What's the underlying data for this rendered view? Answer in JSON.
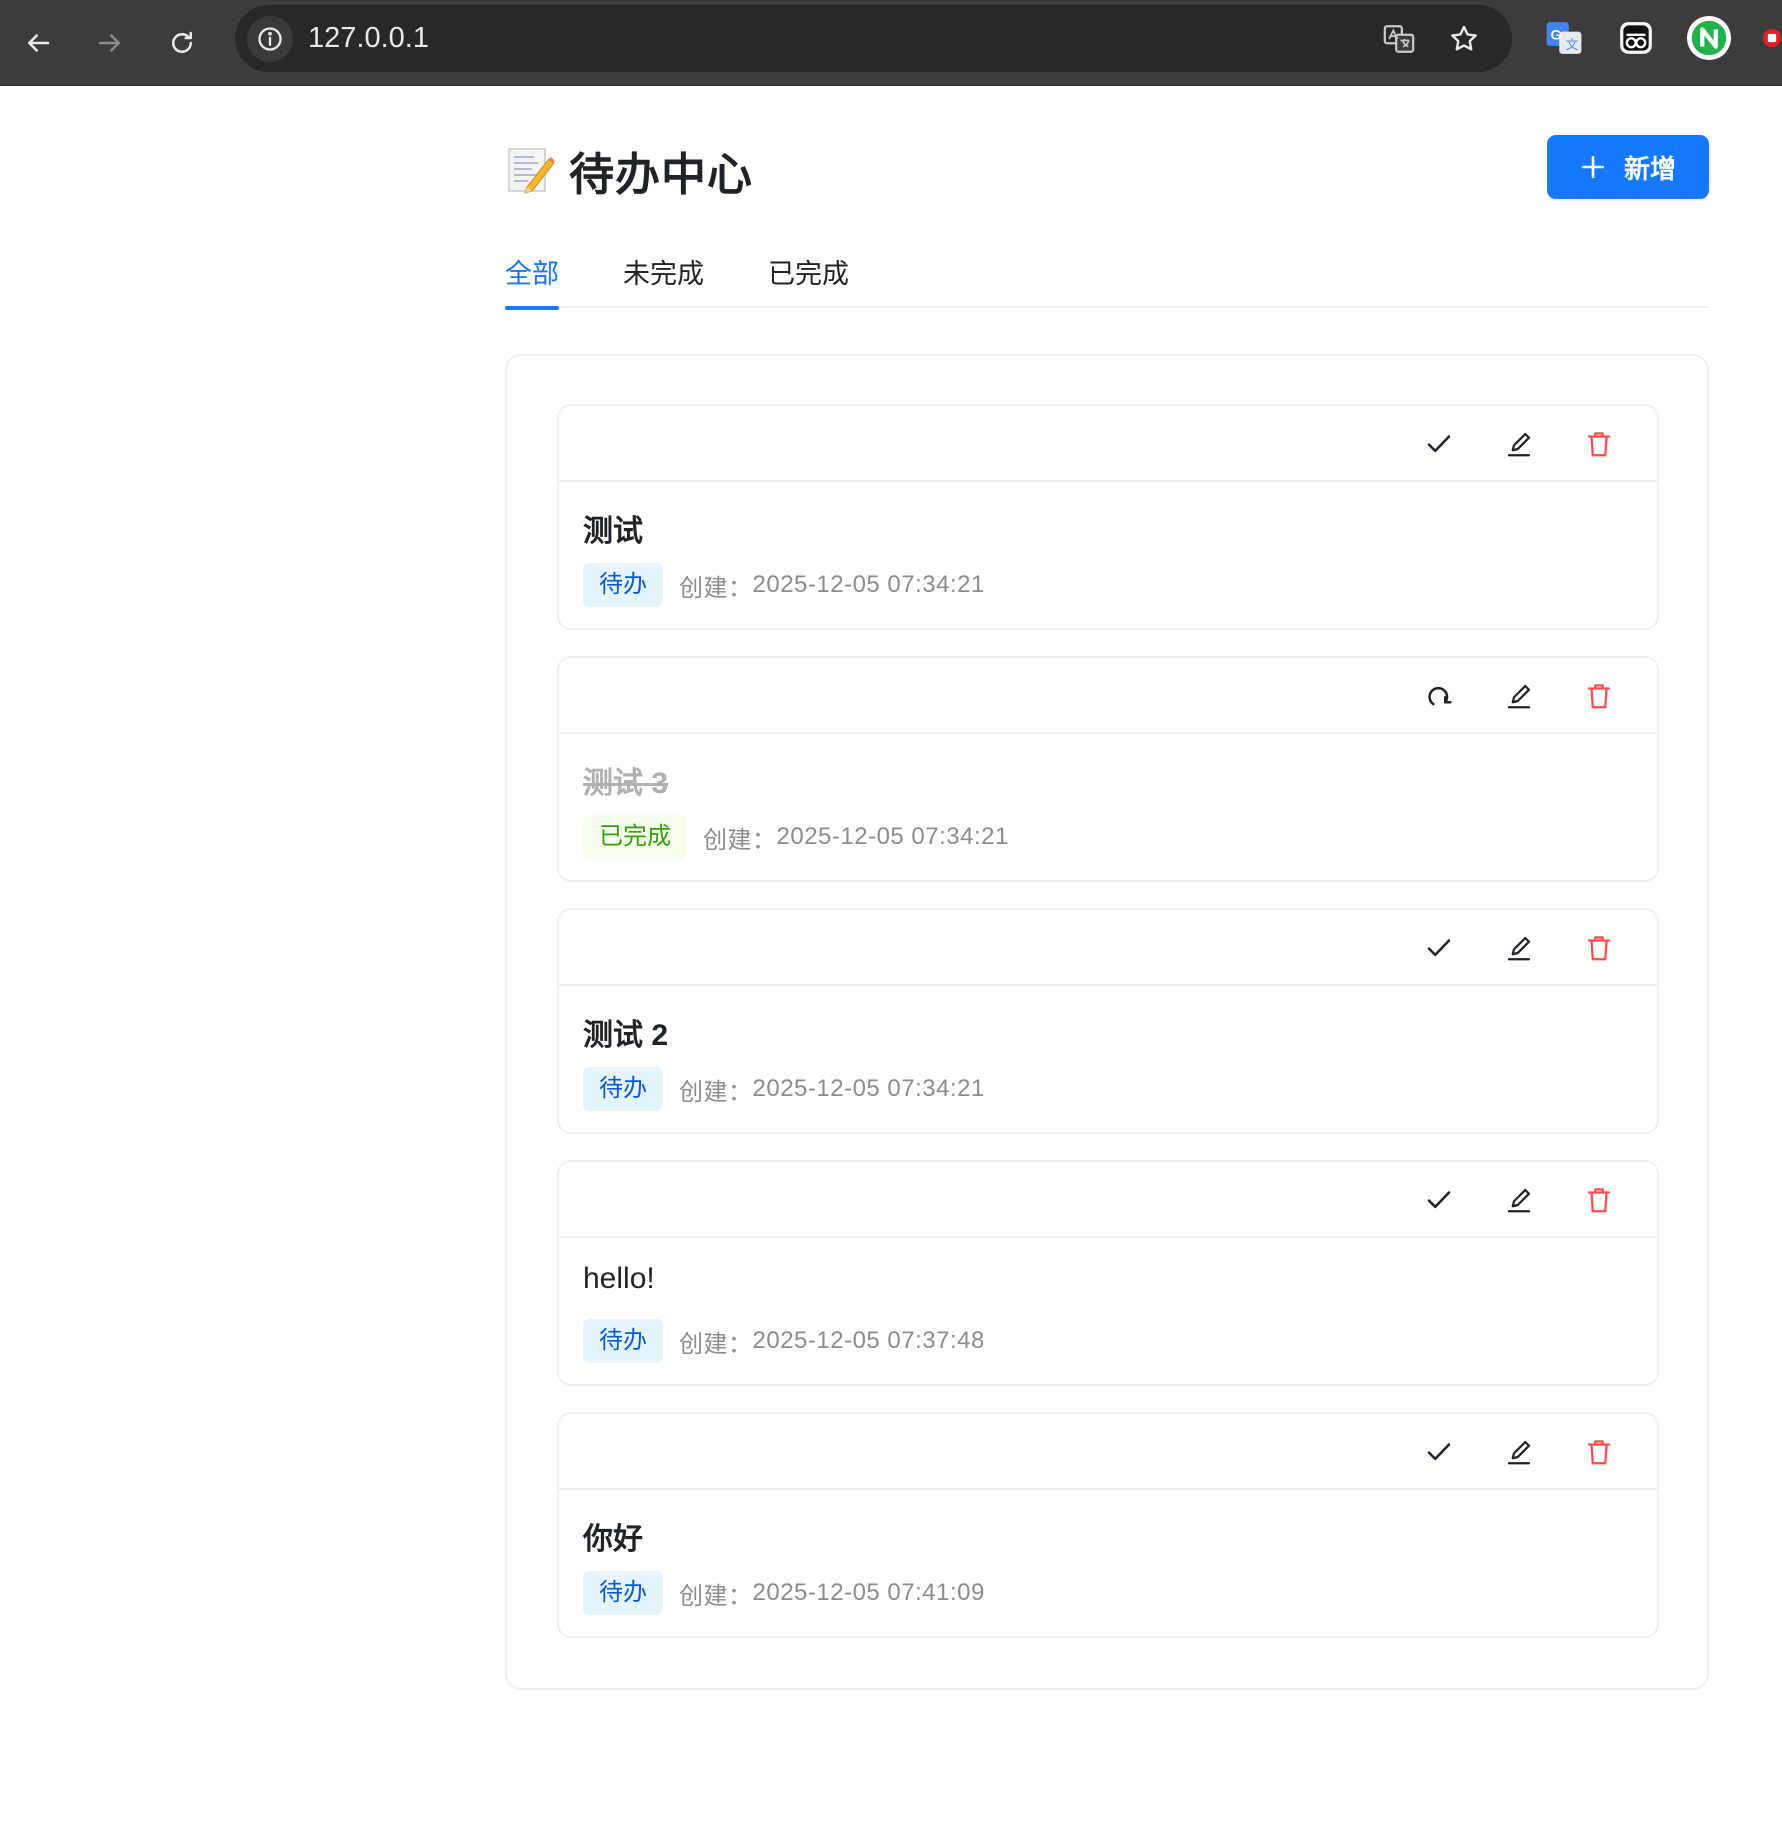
{
  "browser": {
    "url": "127.0.0.1"
  },
  "header": {
    "title": "待办中心",
    "add_label": "新增"
  },
  "tabs": [
    {
      "label": "全部"
    },
    {
      "label": "未完成"
    },
    {
      "label": "已完成"
    }
  ],
  "todos": [
    {
      "title": "测试",
      "status_label": "待办",
      "created_label": "创建：",
      "created_at": "2025-12-05 07:34:21"
    },
    {
      "title": "测试 3",
      "status_label": "已完成",
      "created_label": "创建：",
      "created_at": "2025-12-05 07:34:21"
    },
    {
      "title": "测试 2",
      "status_label": "待办",
      "created_label": "创建：",
      "created_at": "2025-12-05 07:34:21"
    },
    {
      "title": "hello!",
      "status_label": "待办",
      "created_label": "创建：",
      "created_at": "2025-12-05 07:37:48"
    },
    {
      "title": "你好",
      "status_label": "待办",
      "created_label": "创建：",
      "created_at": "2025-12-05 07:41:09"
    }
  ],
  "colors": {
    "primary": "#1677ff",
    "danger": "#ff4d4f",
    "pending_tag_bg": "#e6f4ff",
    "done_tag_bg": "#f6ffed"
  }
}
